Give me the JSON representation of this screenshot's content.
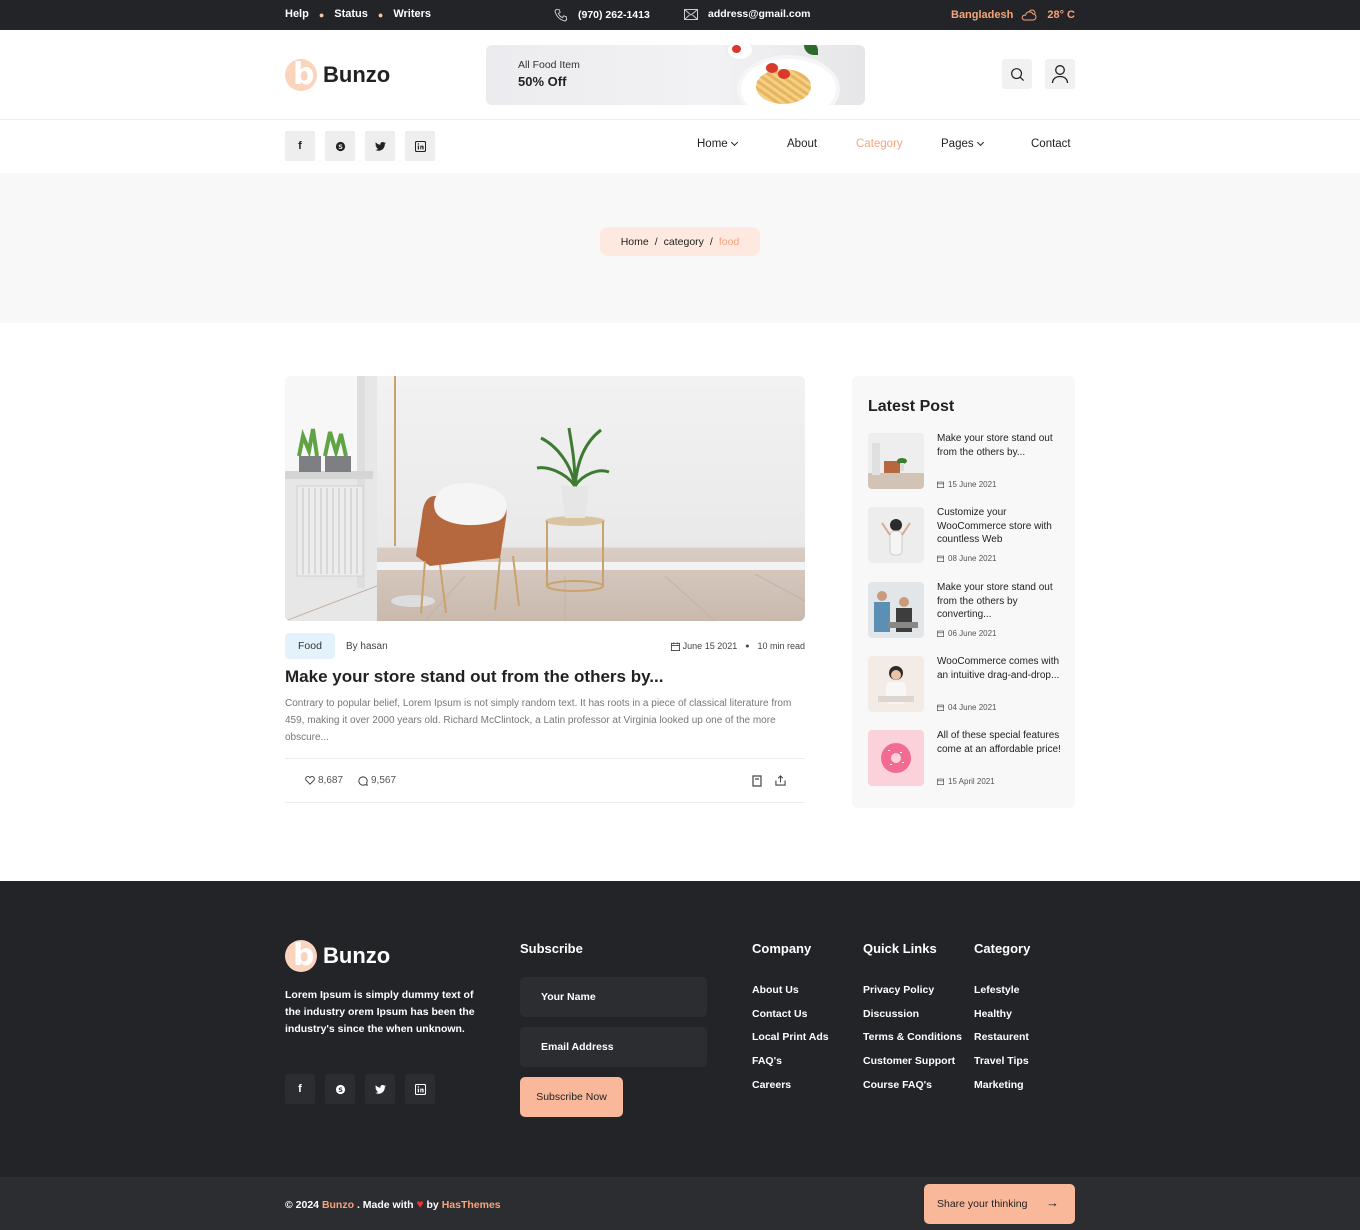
{
  "topbar": {
    "links": [
      "Help",
      "Status",
      "Writers"
    ],
    "phone": "(970) 262-1413",
    "email": "address@gmail.com",
    "location": "Bangladesh",
    "temperature": "28° C",
    "weather_icon": "cloud-sun-icon"
  },
  "brand": {
    "name": "Bunzo",
    "accent": "#f9b89a"
  },
  "banner": {
    "line1": "All Food Item",
    "line2": "50% Off"
  },
  "header_icons": [
    "search-icon",
    "user-icon"
  ],
  "socials": [
    "f",
    "S",
    "t",
    "in"
  ],
  "nav": {
    "items": [
      "Home",
      "About",
      "Category",
      "Pages",
      "Contact"
    ],
    "active": "Category"
  },
  "breadcrumb": {
    "home": "Home",
    "sep": "/",
    "category": "category",
    "current": "food"
  },
  "post": {
    "tag": "Food",
    "author": "By hasan",
    "date": "June 15 2021",
    "read": "10 min read",
    "title": "Make your store stand out from the others by...",
    "excerpt": "Contrary to popular belief, Lorem Ipsum is not simply random text. It has roots in a piece of classical literature from 459, making it over 2000 years old. Richard McClintock, a Latin professor at Virginia looked up one of the more obscure...",
    "likes": "8,687",
    "comments": "9,567"
  },
  "sidebar": {
    "title": "Latest Post",
    "posts": [
      {
        "title": "Make your store stand out from the others by...",
        "date": "15 June 2021"
      },
      {
        "title": "Customize your WooCommerce store with countless Web",
        "date": "08 June 2021"
      },
      {
        "title": "Make your store stand out from the others by converting...",
        "date": "06 June 2021"
      },
      {
        "title": "WooCommerce comes with an intuitive drag-and-drop...",
        "date": "04 June 2021"
      },
      {
        "title": "All of these special features come at an affordable price!",
        "date": "15 April 2021"
      }
    ]
  },
  "footer": {
    "description": "Lorem Ipsum is simply dummy text of the industry orem Ipsum has been the industry's since the when unknown.",
    "subscribe": {
      "title": "Subscribe",
      "name_placeholder": "Your Name",
      "email_placeholder": "Email Address",
      "button": "Subscribe Now"
    },
    "company": {
      "title": "Company",
      "links": [
        "About Us",
        "Contact Us",
        "Local Print Ads",
        "FAQ's",
        "Careers"
      ]
    },
    "quick": {
      "title": "Quick Links",
      "links": [
        "Privacy Policy",
        "Discussion",
        "Terms & Conditions",
        "Customer Support",
        "Course FAQ's"
      ]
    },
    "category": {
      "title": "Category",
      "links": [
        "Lefestyle",
        "Healthy",
        "Restaurent",
        "Travel Tips",
        "Marketing"
      ]
    }
  },
  "bottom": {
    "copyright": "© 2024",
    "brand": "Bunzo",
    "made_with": ". Made with",
    "by": "by",
    "company": "HasThemes",
    "share": "Share your thinking"
  }
}
